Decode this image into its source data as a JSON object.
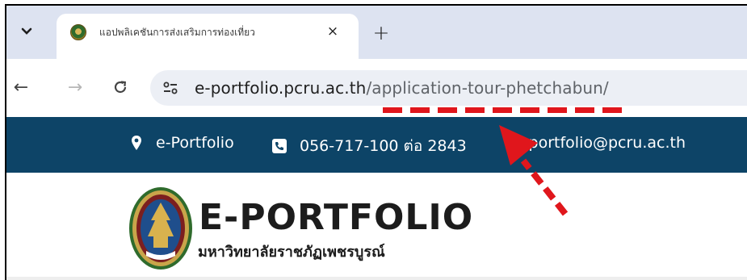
{
  "browser": {
    "tab": {
      "title": "แอปพลิเคชันการส่งเสริมการท่องเที่ยว",
      "close_glyph": "×",
      "favicon": "university-seal-icon"
    },
    "new_tab_glyph": "+",
    "tab_menu_glyph": "⌄",
    "toolbar": {
      "back_glyph": "←",
      "forward_glyph": "→",
      "reload_glyph": "C"
    },
    "url": {
      "host": "e-portfolio.pcru.ac.th",
      "path": "/application-tour-phetchabun/"
    }
  },
  "site": {
    "topbar": {
      "portfolio_label": "e-Portfolio",
      "phone_label": "056-717-100 ต่อ 2843",
      "email_label": "e-portfolio@pcru.ac.th"
    },
    "brand": {
      "title": "E-PORTFOLIO",
      "subtitle": "มหาวิทยาลัยราชภัฏเพชรบูรณ์"
    }
  },
  "colors": {
    "tabstrip": "#dde3f1",
    "site_bar": "#0d4467",
    "annotation": "#e0161c"
  },
  "icons": [
    "map-pin-icon",
    "phone-icon",
    "email-icon",
    "site-info-icon",
    "university-seal-icon"
  ]
}
